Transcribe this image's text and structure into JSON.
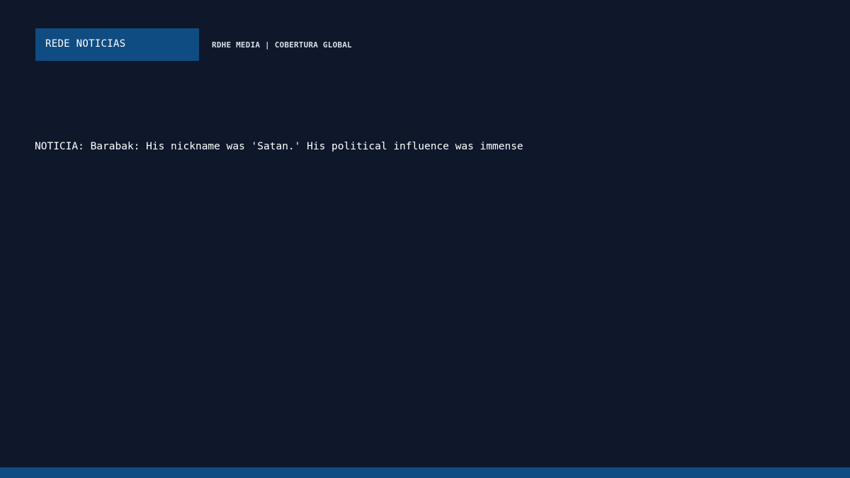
{
  "header": {
    "brand": "REDE NOTICIAS",
    "tagline": "RDHE MEDIA | COBERTURA GLOBAL"
  },
  "main": {
    "headline": "NOTICIA: Barabak: His nickname was 'Satan.' His political influence was immense"
  },
  "colors": {
    "background": "#0e182a",
    "accent": "#0f4c82",
    "text": "#ffffff",
    "tagline_text": "#d6deea"
  }
}
